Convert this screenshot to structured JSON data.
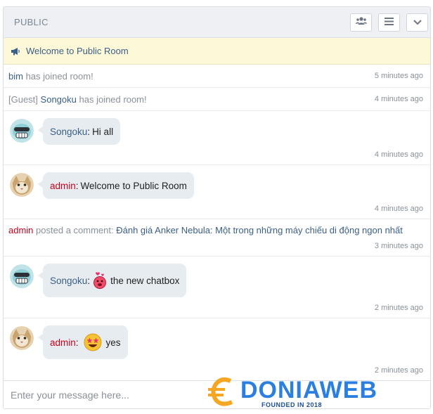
{
  "header": {
    "title": "PUBLIC"
  },
  "icons": {
    "users": "users-icon",
    "menu": "menu-icon",
    "collapse": "chevron-down-icon",
    "announce": "bullhorn-icon"
  },
  "notice": {
    "text": "Welcome to Public Room"
  },
  "events": [
    {
      "prefix": "",
      "user": "bim",
      "action": "has joined room!",
      "time": "5 minutes ago"
    },
    {
      "prefix": "[Guest]",
      "user": "Songoku",
      "action": "has joined room!",
      "time": "4 minutes ago"
    }
  ],
  "messages": [
    {
      "user": "Songoku",
      "text": "Hi all",
      "time": "4 minutes ago",
      "emoji": "",
      "avatar": "songoku-avatar"
    },
    {
      "user": "admin",
      "text": "Welcome to Public Room",
      "time": "4 minutes ago",
      "emoji": "",
      "avatar": "admin-avatar"
    },
    {
      "user": "Songoku",
      "text": "the new chatbox",
      "time": "2 minutes ago",
      "emoji": "love-emoji",
      "avatar": "songoku-avatar"
    },
    {
      "user": "admin",
      "text": "yes",
      "time": "2 minutes ago",
      "emoji": "star-eyes-emoji",
      "avatar": "admin-avatar"
    }
  ],
  "comment": {
    "user": "admin",
    "text": "posted a comment:",
    "link": "Đánh giá Anker Nebula: Một trong những máy chiếu di động ngon nhất",
    "time": "3 minutes ago"
  },
  "input": {
    "placeholder": "Enter your message here..."
  },
  "watermark": {
    "text": "DONIAWEB",
    "sub": "FOUNDED IN 2018"
  },
  "colors": {
    "user": "#3b5f86",
    "admin": "#d0021b",
    "notice_bg": "#fdf8d8",
    "bubble_bg": "#e7ecf1"
  }
}
